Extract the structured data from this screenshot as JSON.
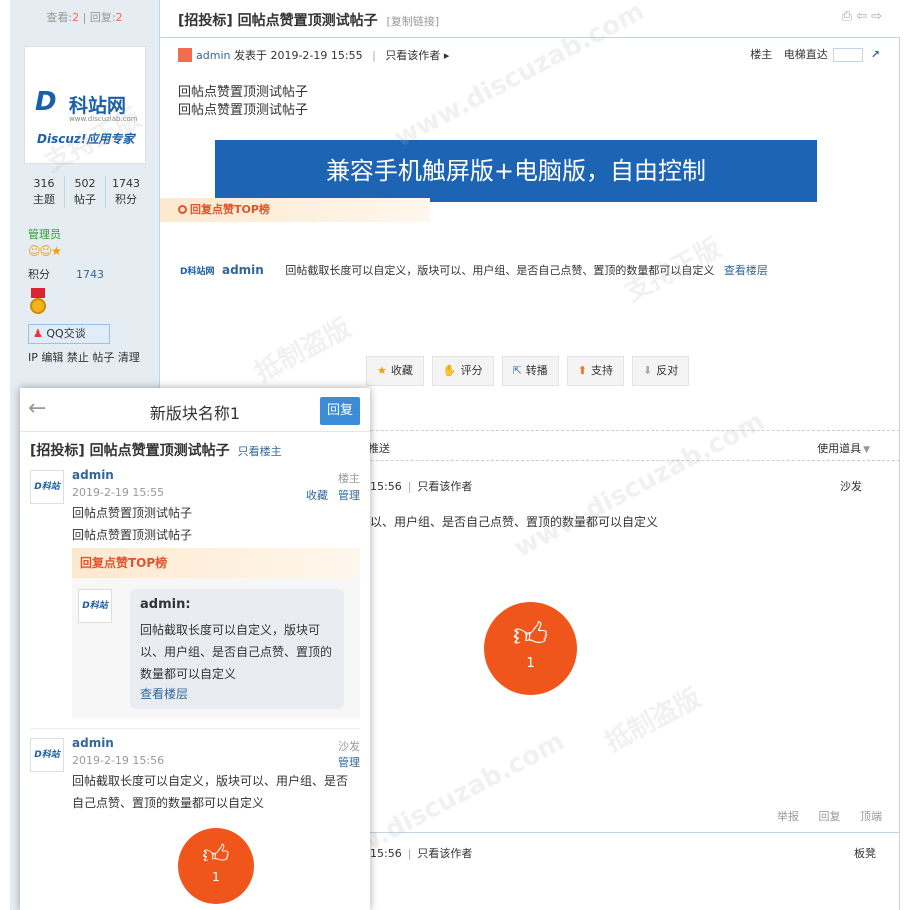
{
  "topbar": {
    "views_label": "查看:",
    "views": "2",
    "divider": "|",
    "replies_label": "回复:",
    "replies": "2",
    "title": "[招投标] 回帖点赞置顶测试帖子",
    "copy_link": "[复制链接]",
    "tool_icons": [
      "print-icon",
      "prev-icon",
      "next-icon"
    ]
  },
  "user": {
    "logo_mark": "D",
    "logo_cn": "科站网",
    "logo_url": "www.discuzlab.com",
    "logo_sub": "Discuz!应用专家",
    "stats": [
      {
        "value": "316",
        "label": "主题"
      },
      {
        "value": "502",
        "label": "帖子"
      },
      {
        "value": "1743",
        "label": "积分"
      }
    ],
    "role": "管理员",
    "points_label": "积分",
    "points_value": "1743",
    "qq_label": "QQ交谈",
    "admin_links": "IP 编辑 禁止 帖子 清理"
  },
  "post": {
    "author": "admin",
    "posted_at": "发表于 2019-2-19 15:55",
    "only_author": "只看该作者",
    "floor": "楼主",
    "jump_label": "电梯直达",
    "body_lines": [
      "回帖点赞置顶测试帖子",
      "回帖点赞置顶测试帖子"
    ],
    "banner": "兼容手机触屏版+电脑版，自由控制",
    "top_header": "回复点赞TOP榜",
    "reply_logo": "D科站网",
    "reply_author": "admin",
    "reply_text": "回帖截取长度可以自定义，版块可以、用户组、是否自己点赞、置顶的数量都可以自定义",
    "view_floor": "查看楼层",
    "actions": [
      {
        "icon": "star-icon",
        "label": "收藏"
      },
      {
        "icon": "rate-icon",
        "label": "评分"
      },
      {
        "icon": "share-icon",
        "label": "转播"
      },
      {
        "icon": "support-icon",
        "label": "支持"
      },
      {
        "icon": "oppose-icon",
        "label": "反对"
      }
    ],
    "push": "推送",
    "tools": "使用道具"
  },
  "reply2": {
    "time": "15:56",
    "only_author": "只看该作者",
    "floor": "沙发",
    "text": "以、用户组、是否自己点赞、置顶的数量都可以自定义",
    "like_count": "1",
    "faint_items": [
      "举报",
      "回复",
      "顶端"
    ]
  },
  "reply3": {
    "time": "15:56",
    "only_author": "只看该作者",
    "floor": "板凳"
  },
  "mobile": {
    "back_icon": "back-arrow-icon",
    "title": "新版块名称1",
    "reply": "回复",
    "post_title": "[招投标] 回帖点赞置顶测试帖子",
    "only_op": "只看楼主",
    "p1_author": "admin",
    "p1_date": "2019-2-19 15:55",
    "p1_floor": "楼主",
    "p1_fav": "收藏",
    "p1_manage": "管理",
    "p1_lines": [
      "回帖点赞置顶测试帖子",
      "回帖点赞置顶测试帖子"
    ],
    "top_header": "回复点赞TOP榜",
    "bubble_name": "admin:",
    "bubble_text": "回帖截取长度可以自定义，版块可以、用户组、是否自己点赞、置顶的数量都可以自定义",
    "bubble_link": "查看楼层",
    "p2_author": "admin",
    "p2_date": "2019-2-19 15:56",
    "p2_floor": "沙发",
    "p2_manage": "管理",
    "p2_text": "回帖截取长度可以自定义，版块可以、用户组、是否自己点赞、置顶的数量都可以自定义",
    "like_count": "1"
  },
  "colors": {
    "accent_blue": "#1e64b4",
    "like_orange": "#f0561b",
    "sidebar_bg": "#e5edf2"
  }
}
